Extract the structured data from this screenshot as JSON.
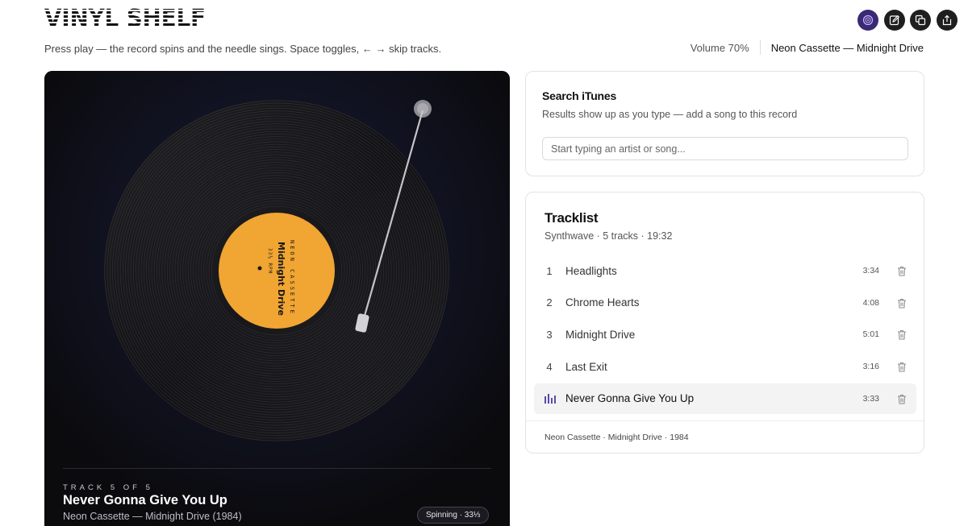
{
  "header": {
    "logo_text": "VINYL SHELF",
    "subtitle": "Press play — the record spins and the needle sings. Space toggles, ← → skip tracks.",
    "actions": [
      {
        "name": "record-icon"
      },
      {
        "name": "edit-icon"
      },
      {
        "name": "copy-icon"
      },
      {
        "name": "share-icon"
      }
    ],
    "volume_label": "Volume 70%",
    "now_playing_label": "Neon Cassette — Midnight Drive"
  },
  "player": {
    "record_label": {
      "artist": "NEON CASSETTE",
      "album": "Midnight Drive",
      "speed": "33⅓ RPM",
      "color": "#f1a532"
    },
    "track_position": "TRACK 5 OF 5",
    "title": "Never Gonna Give You Up",
    "subtitle": "Neon Cassette — Midnight Drive (1984)",
    "status": "Spinning · 33⅓"
  },
  "search": {
    "title": "Search iTunes",
    "hint": "Results show up as you type — add a song to this record",
    "input_value": "",
    "placeholder": "Start typing an artist or song..."
  },
  "tracklist": {
    "title": "Tracklist",
    "meta": "Synthwave · 5 tracks · 19:32",
    "tracks": [
      {
        "num": "1",
        "title": "Headlights",
        "duration": "3:34",
        "active": false
      },
      {
        "num": "2",
        "title": "Chrome Hearts",
        "duration": "4:08",
        "active": false
      },
      {
        "num": "3",
        "title": "Midnight Drive",
        "duration": "5:01",
        "active": false
      },
      {
        "num": "4",
        "title": "Last Exit",
        "duration": "3:16",
        "active": false
      },
      {
        "num": "5",
        "title": "Never Gonna Give You Up",
        "duration": "3:33",
        "active": true
      }
    ],
    "footer": "Neon Cassette · Midnight Drive · 1984"
  },
  "colors": {
    "accent": "#5b4aa8",
    "player_bg": "#0d0d10",
    "label": "#f1a532"
  }
}
